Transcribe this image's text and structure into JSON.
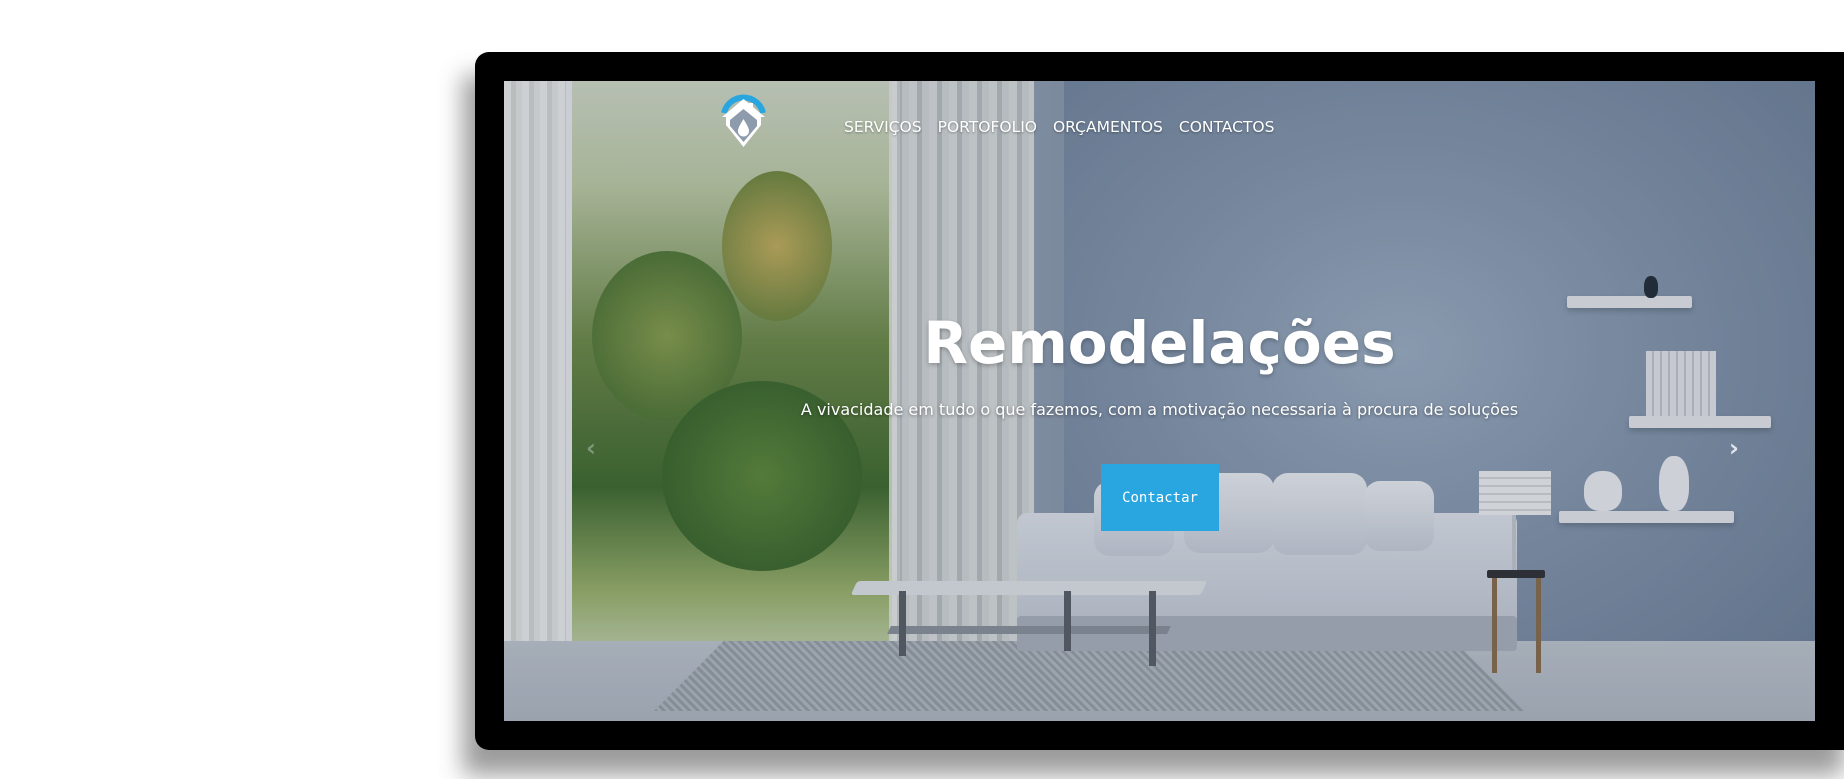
{
  "nav": {
    "items": [
      {
        "label": "SERVIÇOS"
      },
      {
        "label": "PORTOFOLIO"
      },
      {
        "label": "ORÇAMENTOS"
      },
      {
        "label": "CONTACTOS"
      }
    ]
  },
  "hero": {
    "title": "Remodelações",
    "subtitle": "A vivacidade em tudo o que fazemos, com a motivação necessaria à procura de soluções",
    "cta_label": "Contactar",
    "prev_arrow": "‹",
    "next_arrow": "›"
  },
  "colors": {
    "accent": "#29a6e0",
    "frame": "#000000",
    "text": "#ffffff"
  },
  "icons": {
    "logo": "house-drop-logo-icon",
    "prev": "chevron-left-icon",
    "next": "chevron-right-icon"
  }
}
